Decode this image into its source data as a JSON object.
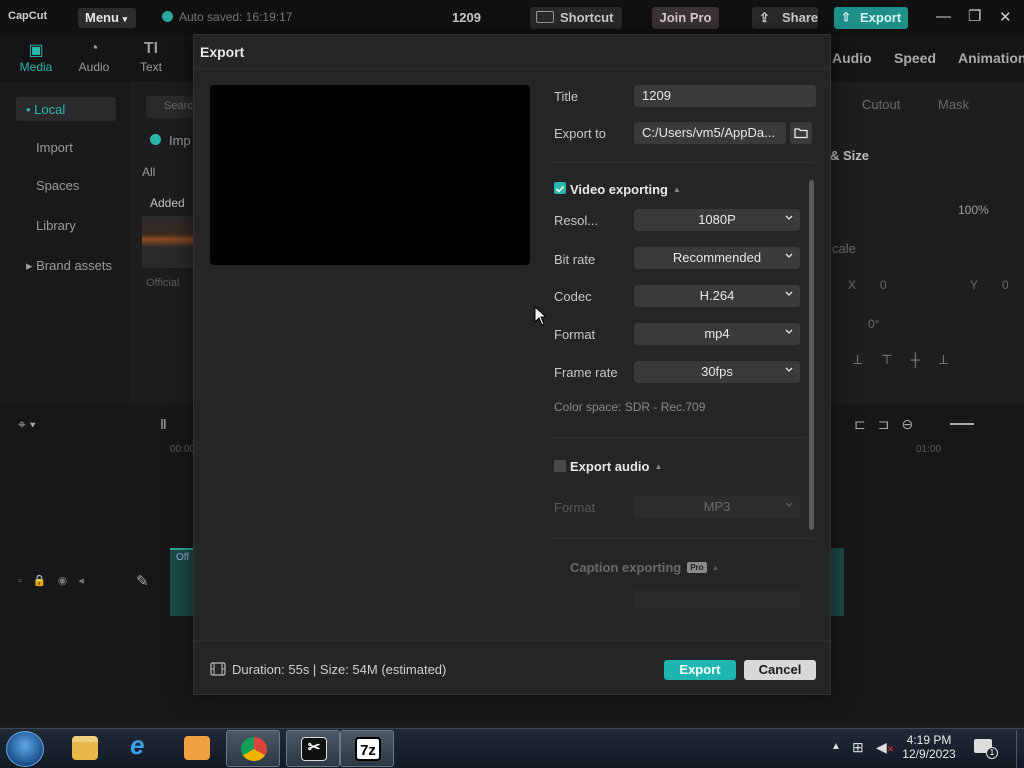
{
  "app": {
    "logo": "CapCut",
    "menu_label": "Menu",
    "autosave_text": "Auto saved: 16:19:17",
    "project_name": "1209",
    "shortcut_label": "Shortcut",
    "join_pro_label": "Join Pro",
    "share_label": "Share",
    "export_label": "Export"
  },
  "media_tabs": [
    {
      "label": "Media",
      "icon": "media-icon"
    },
    {
      "label": "Audio",
      "icon": "audio-icon"
    },
    {
      "label": "Text",
      "icon": "text-icon"
    }
  ],
  "sidebar": {
    "items": [
      "Local",
      "Import",
      "Spaces",
      "Library",
      "Brand assets"
    ]
  },
  "media_panel": {
    "search_placeholder": "Search",
    "import_label": "Imp",
    "all_label": "All",
    "added_label": "Added",
    "official_label": "Official"
  },
  "right_tabs": [
    "Audio",
    "Speed",
    "Animation"
  ],
  "right_panel": {
    "subtabs": [
      "Cutout",
      "Mask"
    ],
    "size_label": "& Size",
    "scale_value": "100%",
    "scale_label": "cale",
    "x_label": "X",
    "x_value": "0",
    "y_label": "Y",
    "y_value": "0",
    "rotation_value": "0°"
  },
  "timeline": {
    "time_start": "00:00",
    "time_end": "01:00",
    "clip_label": "Off"
  },
  "dialog": {
    "title": "Export",
    "title_label": "Title",
    "title_value": "1209",
    "export_to_label": "Export to",
    "export_to_value": "C:/Users/vm5/AppDa...",
    "video": {
      "section_label": "Video exporting",
      "resolution_label": "Resol...",
      "resolution_value": "1080P",
      "bitrate_label": "Bit rate",
      "bitrate_value": "Recommended",
      "codec_label": "Codec",
      "codec_value": "H.264",
      "format_label": "Format",
      "format_value": "mp4",
      "framerate_label": "Frame rate",
      "framerate_value": "30fps",
      "color_space": "Color space: SDR - Rec.709"
    },
    "audio": {
      "section_label": "Export audio",
      "format_label": "Format",
      "format_value": "MP3"
    },
    "caption": {
      "section_label": "Caption exporting",
      "badge": "Pro"
    },
    "footer_info": "Duration: 55s | Size: 54M (estimated)",
    "export_button": "Export",
    "cancel_button": "Cancel"
  },
  "taskbar": {
    "time": "4:19 PM",
    "date": "12/9/2023",
    "notif_count": "1",
    "apps": [
      "file-explorer-icon",
      "internet-explorer-icon",
      "media-player-icon",
      "chrome-icon",
      "capcut-icon",
      "7zip-icon"
    ]
  }
}
